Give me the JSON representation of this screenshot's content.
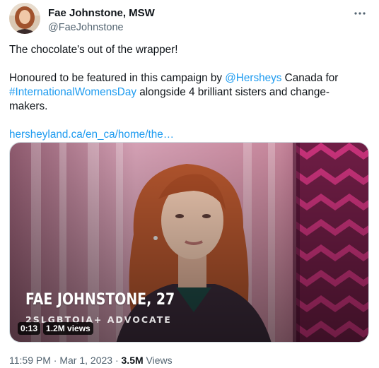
{
  "author": {
    "display_name": "Fae Johnstone, MSW",
    "handle": "@FaeJohnstone"
  },
  "tweet": {
    "line1": "The chocolate's out of the wrapper!",
    "line2_pre": "Honoured to be featured in this campaign by ",
    "mention": "@Hersheys",
    "line2_post": " Canada for",
    "hashtag": "#InternationalWomensDay",
    "line3_post": " alongside 4 brilliant sisters and change-",
    "line4": "makers.",
    "url": "hersheyland.ca/en_ca/home/the…"
  },
  "media": {
    "title": "FAE JOHNSTONE, 27",
    "subtitle": "2SLGBTQIA+ ADVOCATE",
    "duration": "0:13",
    "views": "1.2M views"
  },
  "meta": {
    "time": "11:59 PM",
    "sep1": " · ",
    "date": "Mar 1, 2023",
    "sep2": " · ",
    "views_count": "3.5M",
    "views_label": " Views"
  },
  "icons": {
    "more": "more-horizontal-icon"
  },
  "colors": {
    "link": "#1d9bf0",
    "text": "#0f1419",
    "secondary": "#536471",
    "media_bg": "#c98aa0",
    "accent_pattern": "#b02a6d"
  }
}
